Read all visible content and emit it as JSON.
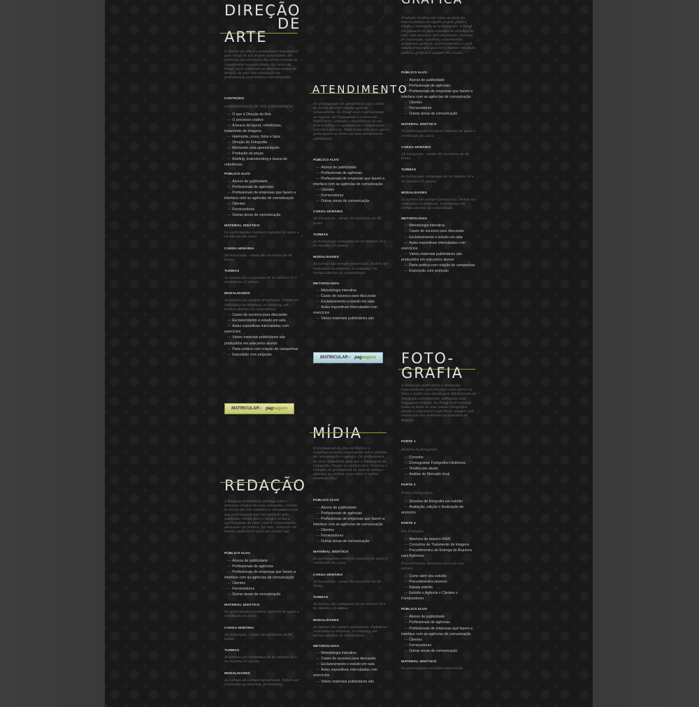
{
  "colors": {
    "accent": "#8aa23a",
    "text": "#e4e4e4",
    "muted": "#787878"
  },
  "sections": {
    "direcao": {
      "title_line1": "DIREÇÃO",
      "title_line2": "DE",
      "title_line3": "ARTE",
      "intro": "O diretor de arte é o profissional responsável pelo visual de um projeto publicitário. Ele participa da concepção das ideias e ideias ao visualmente na publicidade. No curso da Pangl, você conhecerá as diversas etapas de direção de arte com orientação de profissionais experientes e reconhecidos.",
      "conteudo_label": "CONTEÚDO",
      "conteudo_sub": "A IMPORTÂNCIA DE VER A DIFERENÇA:",
      "conteudo": [
        "O que é Direção de Arte",
        "O processo criativo",
        "A busca do layout, referências, tratamento de imagens",
        "Harmonia, cores, fotos e tipos",
        "Direção de Fotografia",
        "Montando uma apresentação",
        "Produção de peças",
        "Briefing, brainstorming e busca de referências"
      ],
      "publico_label": "PÚBLICO ALVO",
      "publico": [
        "Alunos de publicidade",
        "Profissionais de agências",
        "Profissionais de empresas que fazem a interface com as agências de comunicação",
        "Clientes",
        "Fornecedores",
        "Outras áreas de comunicação"
      ],
      "material_label": "MATERIAL DIDÁTICO",
      "material": "Os participantes recebem material de apoio e certificado do curso.",
      "carga_label": "CARGA HORÁRIA",
      "carga": "24 horas/aula – sendo 06 encontros de 04 horas.",
      "turmas_label": "TURMAS",
      "turmas": "As turmas são compostas de no mínimo 10 e no máximo 25 alunos.",
      "modalidades_label": "MODALIDADES",
      "modalidades": "As turmas são sempre presenciais. Podem ser realizadas na empresa, in company, em turmas abertas ou corporativas.",
      "metodo": [
        "Cases de sucesso para discussão",
        "Esclarecimento e estudo em sala",
        "Aulas expositivas intercaladas com exercícios",
        "Vários materiais publicitários são produzidos em sala pelos alunos",
        "Parte prática com criação de campanhas",
        "Exposição com projeção"
      ],
      "btn_left": "MATRICULAR ›",
      "btn_pag": "pag",
      "btn_seguro": "seguro"
    },
    "redacao": {
      "title": "REDAÇÃO",
      "intro": "A Redação Publicitária abrange todo o processo criativo de uma campanha, criando os textos de criar anúncios e adequados para que a mensagem seja interpretada pelo publicado. Venha para a Pangl e tenha a oportunidade de obter todo o conhecimento adequado em prática. Por isso, vivenciar um mundo publicitário para um cliente real.",
      "publico_label": "PÚBLICO ALVO",
      "publico": [
        "Alunos de publicidade",
        "Profissionais de agências",
        "Profissionais de empresas que fazem a interface com as agências de comunicação",
        "Clientes",
        "Fornecedores",
        "Outras áreas de comunicação"
      ],
      "material_label": "MATERIAL DIDÁTICO",
      "material": "Os participantes recebem material de apoio e certificado do curso.",
      "carga_label": "CARGA HORÁRIA",
      "carga": "24 horas/aula – sendo 06 encontros de 04 horas.",
      "turmas_label": "TURMAS",
      "turmas": "As turmas são compostas de no mínimo 10 e no máximo 25 alunos.",
      "modalidades_label": "MODALIDADES",
      "modalidades": "As turmas são sempre presenciais. Podem ser realizadas na empresa, in company."
    },
    "atendimento": {
      "title": "ATENDIMENTO",
      "intro": "Os profissionais de atendimento são a linha de frente do tripé cliente-agência-fornecedores. Na Pangl você é apresentado ao negócio da Propaganda e o mercado Publicitário, entende a importância de um bom briefing e é apresentado a importantes conceitos básicos. Tudo preparado para que o participante se torne um bom atendimento publicitário.",
      "publico_label": "PÚBLICO ALVO",
      "publico": [
        "Alunos de publicidade",
        "Profissionais de agências",
        "Profissionais de empresas que fazem a interface com as agências de comunicação",
        "Clientes",
        "Fornecedores",
        "Outras áreas de comunicação"
      ],
      "carga_label": "CARGA HORÁRIA",
      "carga": "24 horas/aula – sendo 06 encontros de 04 horas.",
      "turmas_label": "TURMAS",
      "turmas": "As turmas são compostas de no mínimo 10 e no máximo 25 alunos.",
      "modalidades_label": "MODALIDADES",
      "modalidades": "As turmas são sempre presenciais. Podem ser realizadas na empresa, in company, em turmas abertas ou corporativas.",
      "metodologia_label": "METODOLOGIA",
      "metodologia": [
        "Metodologia interativa",
        "Cases de sucesso para discussão",
        "Esclarecimento e estudo em sala",
        "Aulas expositivas intercaladas com exercícios",
        "Vários materiais publicitários são"
      ],
      "btn_left": "MATRICULAR ›",
      "btn_pag": "pag",
      "btn_seguro": "seguro"
    },
    "midia": {
      "title": "MÍDIA",
      "intro": "O profissional da área de Mídia é o responsável pelas negociações entre veículos de comunicação e agência. Os profissionais da área, trabalham para que a mensagem da campanha chegue ao público-alvo. Vivencie o trabalho do profissional da área de mídia e aprenda na prática como obter o melhor resultado final.",
      "publico_label": "PÚBLICO ALVO",
      "publico": [
        "Alunos de publicidade",
        "Profissionais de agências",
        "Profissionais de empresas que fazem a interface com as agências de comunicação",
        "Clientes",
        "Fornecedores",
        "Outras áreas de comunicação"
      ],
      "material_label": "MATERIAL DIDÁTICO",
      "material": "Os participantes recebem material de apoio e certificado do curso.",
      "carga_label": "CARGA HORÁRIA",
      "carga": "24 horas/aula – sendo 06 encontros de 04 horas.",
      "turmas_label": "TURMAS",
      "turmas": "As turmas são compostas de no mínimo 10 e no máximo 25 alunos.",
      "modalidades_label": "MODALIDADES",
      "modalidades": "As turmas são sempre presenciais. Podem ser realizadas na empresa, in company, em turmas abertas ou corporativas.",
      "metodologia_label": "METODOLOGIA",
      "metodologia": [
        "Metodologia interativa",
        "Cases de sucesso para discussão",
        "Esclarecimento e estudo em sala",
        "Aulas expositivas intercaladas com exercícios",
        "Vários materiais publicitários são"
      ]
    },
    "grafica": {
      "title": "GRÁFICA",
      "intro": "Produção Gráfica são todas as fases da materialização de algum projeto gráfico, desde a concepção ao acabamento. A Pangl irá preparar-lo para entender os detalhes de todo este processo (pré-impressão, técnicas de impressão, suportes, acabamentos, problemas gráficos, preenchimentos e você estará preparado para ter o melhor resultado junto às gráficas e equipes de criação.",
      "publico_label": "PÚBLICO ALVO",
      "publico": [
        "Alunos de publicidade",
        "Profissionais de agências",
        "Profissionais de empresas que fazem a interface com as agências de comunicação",
        "Clientes",
        "Fornecedores",
        "Outras áreas de comunicação"
      ],
      "material_label": "MATERIAL DIDÁTICO",
      "material": "Os participantes recebem material de apoio e certificado do curso.",
      "carga_label": "CARGA HORÁRIA",
      "carga": "24 horas/aula – sendo 06 encontros de 04 horas.",
      "turmas_label": "TURMAS",
      "turmas": "As turmas são compostas de no mínimo 10 e no máximo 25 alunos.",
      "modalidades_label": "MODALIDADES",
      "modalidades": "As turmas são sempre presenciais. Podem ser realizadas na empresa, in company, em turmas abertas ou corporativas.",
      "metodologia_label": "METODOLOGIA",
      "metodologia": [
        "Metodologia interativa",
        "Cases de sucesso para discussão",
        "Esclarecimento e estudo em sala",
        "Aulas expositivas intercaladas com exercícios",
        "Vários materiais publicitários são produzidos em sala pelos alunos",
        "Parte prática com criação de campanhas",
        "Exposição com projeção"
      ]
    },
    "fotografia": {
      "title_line1": "FOTO-",
      "title_line2": "GRAFIA",
      "intro": "A fotografia publicitária é produzida especialmente para divulgar uma marca ou ideia e assim uma abordagem diferenciada da fotografia convencional, utilizando uma linguagem própria. Na Pangl você vivencia todas as fases de uma sessão fotográfica (desde a concepção à pós final), sempre com orientação dos melhores profissionais de Brasília.",
      "parte1_label": "PARTE 1",
      "parte1_sub": "História da Fotografia",
      "parte1": [
        "Conceito",
        "Cronograma: Fotógrafos Históricos",
        "Tendências atuais",
        "Análise do Mercado local"
      ],
      "parte2_label": "PARTE 2",
      "parte2_sub": "Prática Fotográfica",
      "parte2": [
        "Sessões de fotografia em estúdio",
        "Avaliação, edição e finalização de anúncios"
      ],
      "parte3_label": "PARTE 3",
      "parte3_sub": "Pós-Produção",
      "parte3": [
        "Abertura de arquivo RAW",
        "Conceitos de Tratamento de imagens",
        "Procedimentos de Entrega de Arquivos para Agências"
      ],
      "admin_sub": "Procedimentos Administrativos de seu estúdio",
      "admin": [
        "Como abrir seu estúdio",
        "Procedimentos internos",
        "Equipe padrão",
        "Estúdio x Agência x Clientes x Fornecedores"
      ],
      "publico_label": "PÚBLICO ALVO",
      "publico": [
        "Alunos de publicidade",
        "Profissionais de agências",
        "Profissionais de empresas que fazem a interface com as agências de comunicação",
        "Clientes",
        "Fornecedores",
        "Outras áreas de comunicação"
      ],
      "material_label": "MATERIAL DIDÁTICO",
      "material": "Os participantes recebem material de"
    }
  }
}
